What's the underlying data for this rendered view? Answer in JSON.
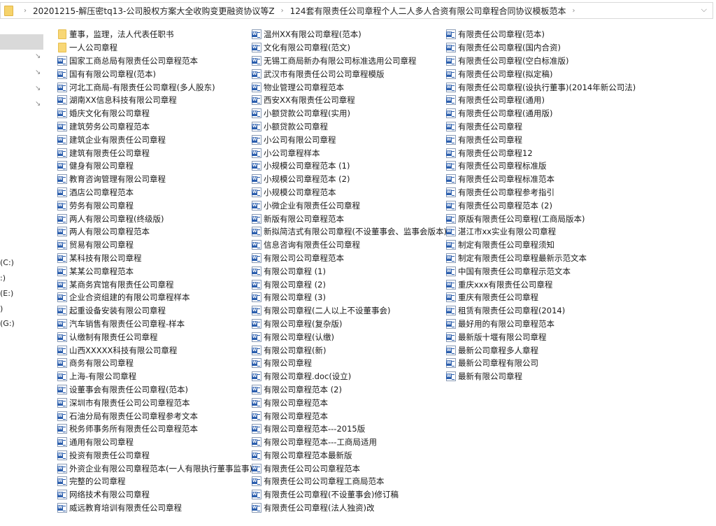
{
  "address_bar": {
    "crumbs": [
      "20201215-解压密tq13-公司股权方案大全收购变更融资协议等Z",
      "124套有限责任公司章程个人二人多人合资有限公司章程合同协议模板范本"
    ],
    "separator": "›",
    "dropdown": "⌄"
  },
  "nav": {
    "pin_icon": "📌",
    "drives": [
      "(C:)",
      ":)",
      "(E:)",
      ")",
      "(G:)"
    ]
  },
  "columns": [
    [
      {
        "type": "folder",
        "name": "董事，监理，法人代表任职书"
      },
      {
        "type": "folder",
        "name": "一人公司章程"
      },
      {
        "type": "doc",
        "name": "国家工商总局有限责任公司章程范本"
      },
      {
        "type": "doc",
        "name": "国有有限公司章程(范本)"
      },
      {
        "type": "doc",
        "name": "河北工商局-有限责任公司章程(多人股东)"
      },
      {
        "type": "doc",
        "name": "湖南XX信息科技有限公司章程"
      },
      {
        "type": "doc",
        "name": "婚庆文化有限公司章程"
      },
      {
        "type": "doc",
        "name": "建筑劳务公司章程范本"
      },
      {
        "type": "doc",
        "name": "建筑企业有限责任公司章程"
      },
      {
        "type": "doc",
        "name": "建筑有限责任公司章程"
      },
      {
        "type": "doc",
        "name": "健身有限公司章程"
      },
      {
        "type": "doc",
        "name": "教育咨询管理有限公司章程"
      },
      {
        "type": "doc",
        "name": "酒店公司章程范本"
      },
      {
        "type": "doc",
        "name": "劳务有限公司章程"
      },
      {
        "type": "doc",
        "name": "两人有限公司章程(终级版)"
      },
      {
        "type": "doc",
        "name": "两人有限公司章程范本"
      },
      {
        "type": "doc",
        "name": "贸易有限公司章程"
      },
      {
        "type": "doc",
        "name": "某科技有限公司章程"
      },
      {
        "type": "doc",
        "name": "某某公司章程范本"
      },
      {
        "type": "doc",
        "name": "某商务宾馆有限责任公司章程"
      },
      {
        "type": "doc",
        "name": "企业合资组建的有限公司章程样本"
      },
      {
        "type": "doc",
        "name": "起重设备安装有限公司章程"
      },
      {
        "type": "doc",
        "name": "汽车销售有限责任公司章程-样本"
      },
      {
        "type": "doc",
        "name": "认缴制有限责任公司章程"
      },
      {
        "type": "doc",
        "name": "山西XXXXX科技有限公司章程"
      },
      {
        "type": "doc",
        "name": "商务有限公司章程"
      },
      {
        "type": "doc",
        "name": "上海-有限公司章程"
      },
      {
        "type": "doc",
        "name": "设董事会有限责任公司章程(范本)"
      },
      {
        "type": "doc",
        "name": "深圳市有限责任公司公司章程范本"
      },
      {
        "type": "doc",
        "name": "石油分局有限责任公司章程参考文本"
      },
      {
        "type": "doc",
        "name": "税务师事务所有限责任公司章程范本"
      },
      {
        "type": "doc",
        "name": "通用有限公司章程"
      },
      {
        "type": "doc",
        "name": "投资有限责任公司章程"
      },
      {
        "type": "doc",
        "name": "外资企业有限公司章程范本(一人有限执行董事监事)"
      },
      {
        "type": "doc",
        "name": "完整的公司章程"
      },
      {
        "type": "doc",
        "name": "网络技术有限公司章程"
      },
      {
        "type": "doc",
        "name": "威远教育培训有限责任公司章程"
      }
    ],
    [
      {
        "type": "doc",
        "name": "温州XX有限公司章程(范本)"
      },
      {
        "type": "doc",
        "name": "文化有限公司章程(范文)"
      },
      {
        "type": "doc",
        "name": "无锡工商局新办有限公司标准选用公司章程"
      },
      {
        "type": "doc",
        "name": "武汉市有限责任公司公司章程模版"
      },
      {
        "type": "doc",
        "name": "物业管理公司章程范本"
      },
      {
        "type": "doc",
        "name": "西安XX有限责任公司章程"
      },
      {
        "type": "doc",
        "name": "小额贷款公司章程(实用)"
      },
      {
        "type": "doc",
        "name": "小额贷款公司章程"
      },
      {
        "type": "doc",
        "name": "小公司有限公司章程"
      },
      {
        "type": "doc",
        "name": "小公司章程样本"
      },
      {
        "type": "doc",
        "name": "小规模公司章程范本 (1)"
      },
      {
        "type": "doc",
        "name": "小规模公司章程范本 (2)"
      },
      {
        "type": "doc",
        "name": "小规模公司章程范本"
      },
      {
        "type": "doc",
        "name": "小微企业有限责任公司章程"
      },
      {
        "type": "doc",
        "name": "新版有限公司章程范本"
      },
      {
        "type": "doc",
        "name": "新拟简洁式有限公司章程(不设董事会、监事会版本)"
      },
      {
        "type": "doc",
        "name": "信息咨询有限责任公司章程"
      },
      {
        "type": "doc",
        "name": "有限公司公司章程范本"
      },
      {
        "type": "doc",
        "name": "有限公司章程 (1)"
      },
      {
        "type": "doc",
        "name": "有限公司章程 (2)"
      },
      {
        "type": "doc",
        "name": "有限公司章程 (3)"
      },
      {
        "type": "doc",
        "name": "有限公司章程(二人以上不设董事会)"
      },
      {
        "type": "doc",
        "name": "有限公司章程(复杂版)"
      },
      {
        "type": "doc",
        "name": "有限公司章程(认缴)"
      },
      {
        "type": "doc",
        "name": "有限公司章程(新)"
      },
      {
        "type": "doc",
        "name": "有限公司章程"
      },
      {
        "type": "doc",
        "name": "有限公司章程.doc(设立)"
      },
      {
        "type": "doc",
        "name": "有限公司章程范本 (2)"
      },
      {
        "type": "doc",
        "name": "有限公司章程范本"
      },
      {
        "type": "doc",
        "name": "有限公司章程范本"
      },
      {
        "type": "doc",
        "name": "有限公司章程范本---2015版"
      },
      {
        "type": "doc",
        "name": "有限公司章程范本---工商局适用"
      },
      {
        "type": "doc",
        "name": "有限公司章程范本最新版"
      },
      {
        "type": "doc",
        "name": "有限责任公司公司章程范本"
      },
      {
        "type": "doc",
        "name": "有限责任公司公司章程工商局范本"
      },
      {
        "type": "doc",
        "name": "有限责任公司章程(不设董事会)修订稿"
      },
      {
        "type": "doc",
        "name": "有限责任公司章程(法人独资)改"
      }
    ],
    [
      {
        "type": "doc",
        "name": "有限责任公司章程(范本)"
      },
      {
        "type": "doc",
        "name": "有限责任公司章程(国内合资)"
      },
      {
        "type": "doc",
        "name": "有限责任公司章程(空白标准版)"
      },
      {
        "type": "doc",
        "name": "有限责任公司章程(拟定稿)"
      },
      {
        "type": "doc",
        "name": "有限责任公司章程(设执行董事)(2014年新公司法)"
      },
      {
        "type": "doc",
        "name": "有限责任公司章程(通用)"
      },
      {
        "type": "doc",
        "name": "有限责任公司章程(通用版)"
      },
      {
        "type": "doc",
        "name": "有限责任公司章程"
      },
      {
        "type": "doc",
        "name": "有限责任公司章程"
      },
      {
        "type": "doc",
        "name": "有限责任公司章程12"
      },
      {
        "type": "doc",
        "name": "有限责任公司章程标准版"
      },
      {
        "type": "doc",
        "name": "有限责任公司章程标准范本"
      },
      {
        "type": "doc",
        "name": "有限责任公司章程参考指引"
      },
      {
        "type": "doc",
        "name": "有限责任公司章程范本 (2)"
      },
      {
        "type": "doc",
        "name": "原版有限责任公司章程(工商局版本)"
      },
      {
        "type": "doc",
        "name": "湛江市xx实业有限公司章程"
      },
      {
        "type": "doc",
        "name": "制定有限责任公司章程须知"
      },
      {
        "type": "doc",
        "name": "制定有限责任公司章程最新示范文本"
      },
      {
        "type": "doc",
        "name": "中国有限责任公司章程示范文本"
      },
      {
        "type": "doc",
        "name": "重庆xxx有限责任公司章程"
      },
      {
        "type": "doc",
        "name": "重庆有限责任公司章程"
      },
      {
        "type": "doc",
        "name": "租赁有限责任公司章程(2014)"
      },
      {
        "type": "doc",
        "name": "最好用的有限公司章程范本"
      },
      {
        "type": "doc",
        "name": "最新版十堰有限公司章程"
      },
      {
        "type": "doc",
        "name": "最新公司章程多人章程"
      },
      {
        "type": "doc",
        "name": "最新公司章程有限公司"
      },
      {
        "type": "doc",
        "name": "最新有限公司章程"
      }
    ]
  ]
}
